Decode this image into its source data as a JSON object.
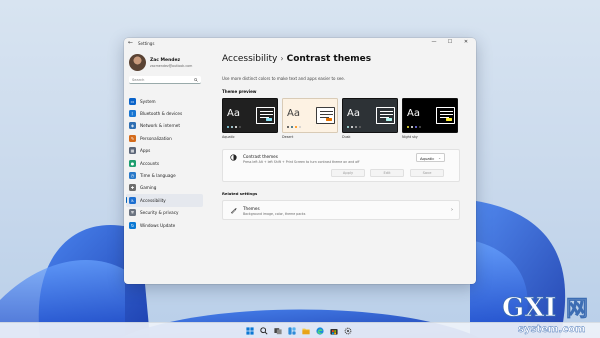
{
  "window": {
    "app_title": "Settings",
    "controls": {
      "minimize": "—",
      "maximize": "☐",
      "close": "✕"
    }
  },
  "profile": {
    "name": "Zac Mendez",
    "email": "zacmendez@outlook.com"
  },
  "search": {
    "placeholder": "Search"
  },
  "nav": {
    "items": [
      {
        "label": "System",
        "icon": "monitor-icon",
        "color": "#0a63c9"
      },
      {
        "label": "Bluetooth & devices",
        "icon": "bluetooth-icon",
        "color": "#1976d2"
      },
      {
        "label": "Network & internet",
        "icon": "network-icon",
        "color": "#2f6fb3"
      },
      {
        "label": "Personalization",
        "icon": "brush-icon",
        "color": "#d46b1b"
      },
      {
        "label": "Apps",
        "icon": "apps-icon",
        "color": "#5b6577"
      },
      {
        "label": "Accounts",
        "icon": "person-icon",
        "color": "#1e9e6e"
      },
      {
        "label": "Time & language",
        "icon": "globe-clock-icon",
        "color": "#2979c9"
      },
      {
        "label": "Gaming",
        "icon": "gamepad-icon",
        "color": "#6d6d6d"
      },
      {
        "label": "Accessibility",
        "icon": "accessibility-icon",
        "color": "#1d6fd0",
        "selected": true
      },
      {
        "label": "Security & privacy",
        "icon": "shield-icon",
        "color": "#6b7380"
      },
      {
        "label": "Windows Update",
        "icon": "update-icon",
        "color": "#0a78d4"
      }
    ]
  },
  "header": {
    "breadcrumb_parent": "Accessibility",
    "separator": "›",
    "breadcrumb_current": "Contrast themes"
  },
  "description": "Use more distinct colors to make text and apps easier to see.",
  "theme_preview": {
    "heading": "Theme preview",
    "themes": [
      {
        "name": "Aquatic",
        "sample": "Aa",
        "bg": "#202020",
        "fg": "#ffffff",
        "dots": [
          "#8ee3f5",
          "#c6f3ff",
          "#ffffff",
          "#555555"
        ],
        "pane_bg": "#202020",
        "pane_line": "#ffffff",
        "pane_btn": "#8ee3f5"
      },
      {
        "name": "Desert",
        "sample": "Aa",
        "bg": "#fdf2e3",
        "fg": "#3d3d3d",
        "dots": [
          "#3d3d3d",
          "#1c5e75",
          "#ff8a00",
          "#cccccc"
        ],
        "pane_bg": "#ffffff",
        "pane_line": "#3d3d3d",
        "pane_btn": "#e36f00"
      },
      {
        "name": "Dusk",
        "sample": "Aa",
        "bg": "#2d3236",
        "fg": "#ffffff",
        "dots": [
          "#b6f6f0",
          "#ffffff",
          "#aaaaaa",
          "#666666"
        ],
        "pane_bg": "#2d3236",
        "pane_line": "#ffffff",
        "pane_btn": "#b6f6f0"
      },
      {
        "name": "Night sky",
        "sample": "Aa",
        "bg": "#000000",
        "fg": "#ffffff",
        "dots": [
          "#ffee32",
          "#ffffff",
          "#8080ff",
          "#555555"
        ],
        "pane_bg": "#000000",
        "pane_line": "#ffffff",
        "pane_btn": "#ffee32"
      }
    ]
  },
  "contrast_themes": {
    "title": "Contrast themes",
    "desc": "Press left Alt + left Shift + Print Screen to turn contrast theme on and off",
    "selected": "Aquatic",
    "buttons": {
      "apply": "Apply",
      "edit": "Edit",
      "save": "Save"
    }
  },
  "related": {
    "heading": "Related settings",
    "themes_title": "Themes",
    "themes_desc": "Background image, color, theme packs"
  },
  "watermark": {
    "main": "GXI",
    "sub": "system.com",
    "chinese": "网"
  }
}
